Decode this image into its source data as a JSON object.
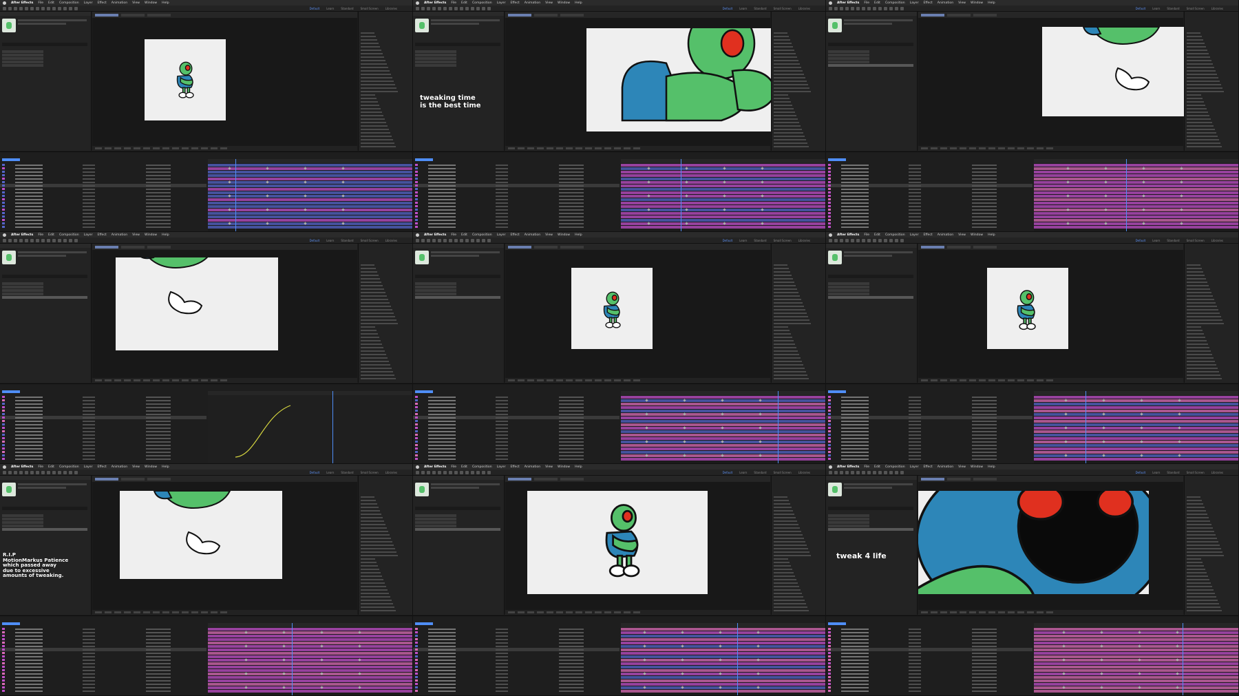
{
  "app": {
    "menu": [
      "After Effects",
      "File",
      "Edit",
      "Composition",
      "Layer",
      "Effect",
      "Animation",
      "View",
      "Window",
      "Help"
    ],
    "workspaces": [
      "Default",
      "Learn",
      "Standard",
      "Small Screen",
      "Libraries"
    ],
    "active_workspace": "Default"
  },
  "overlays": [
    {
      "tile": 1,
      "text": "tweaking time\nis the best time"
    },
    {
      "tile": 6,
      "text": "R.I.P\nMotionMarkus Patience\nwhich passed away\ndue to excessive\namounts of tweaking."
    },
    {
      "tile": 8,
      "text": "tweak 4 life"
    }
  ],
  "colors": {
    "accent": "#4f8ef7",
    "character_green": "#55c06a",
    "jacket_blue": "#2d86b8",
    "eye_red": "#e0301f",
    "outline": "#111111",
    "layer_purple": "#c04fc9",
    "layer_blue": "#5465c9",
    "layer_pink": "#d96bb6"
  }
}
